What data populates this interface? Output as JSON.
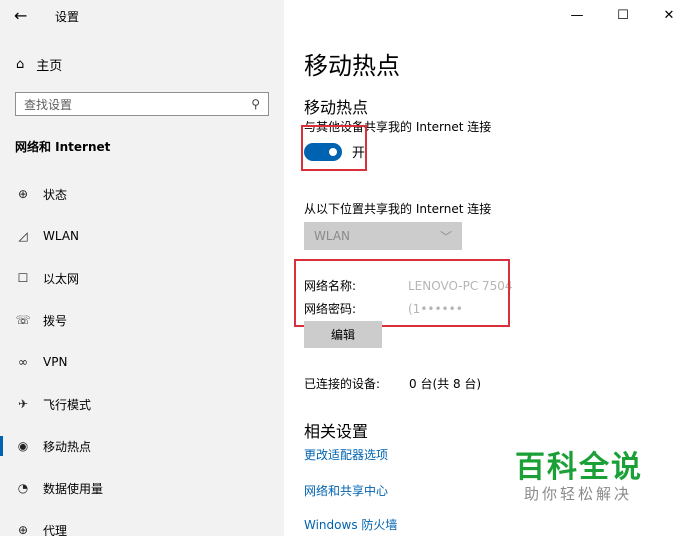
{
  "window": {
    "app_title": "设置",
    "controls": {
      "minimize": "—",
      "maximize": "☐",
      "close": "✕"
    }
  },
  "sidebar": {
    "home_label": "主页",
    "search_placeholder": "查找设置",
    "section_title": "网络和 Internet",
    "items": [
      {
        "label": "状态",
        "icon": "globe-icon"
      },
      {
        "label": "WLAN",
        "icon": "wifi-icon"
      },
      {
        "label": "以太网",
        "icon": "ethernet-icon"
      },
      {
        "label": "拨号",
        "icon": "dialup-icon"
      },
      {
        "label": "VPN",
        "icon": "vpn-icon"
      },
      {
        "label": "飞行模式",
        "icon": "airplane-icon"
      },
      {
        "label": "移动热点",
        "icon": "hotspot-icon",
        "active": true
      },
      {
        "label": "数据使用量",
        "icon": "data-usage-icon"
      },
      {
        "label": "代理",
        "icon": "proxy-icon"
      }
    ]
  },
  "main": {
    "page_title": "移动热点",
    "hotspot_title": "移动热点",
    "hotspot_desc": "与其他设备共享我的 Internet 连接",
    "toggle": {
      "state": "on",
      "label": "开"
    },
    "share_from_label": "从以下位置共享我的 Internet 连接",
    "share_from_value": "WLAN",
    "network_name_label": "网络名称:",
    "network_name_value": "LENOVO-PC 7504",
    "network_password_label": "网络密码:",
    "network_password_value": "(1••••••",
    "edit_button": "编辑",
    "connected_devices_label": "已连接的设备:",
    "connected_devices_value": "0 台(共 8 台)",
    "related_title": "相关设置",
    "links": [
      "更改适配器选项",
      "网络和共享中心",
      "Windows 防火墙"
    ]
  },
  "watermark": {
    "title": "百科全说",
    "subtitle": "助你轻松解决"
  },
  "colors": {
    "accent": "#0063b1",
    "highlight_box": "#d9303b",
    "sidebar_bg": "#f2f2f2",
    "watermark": "#1aa036"
  }
}
